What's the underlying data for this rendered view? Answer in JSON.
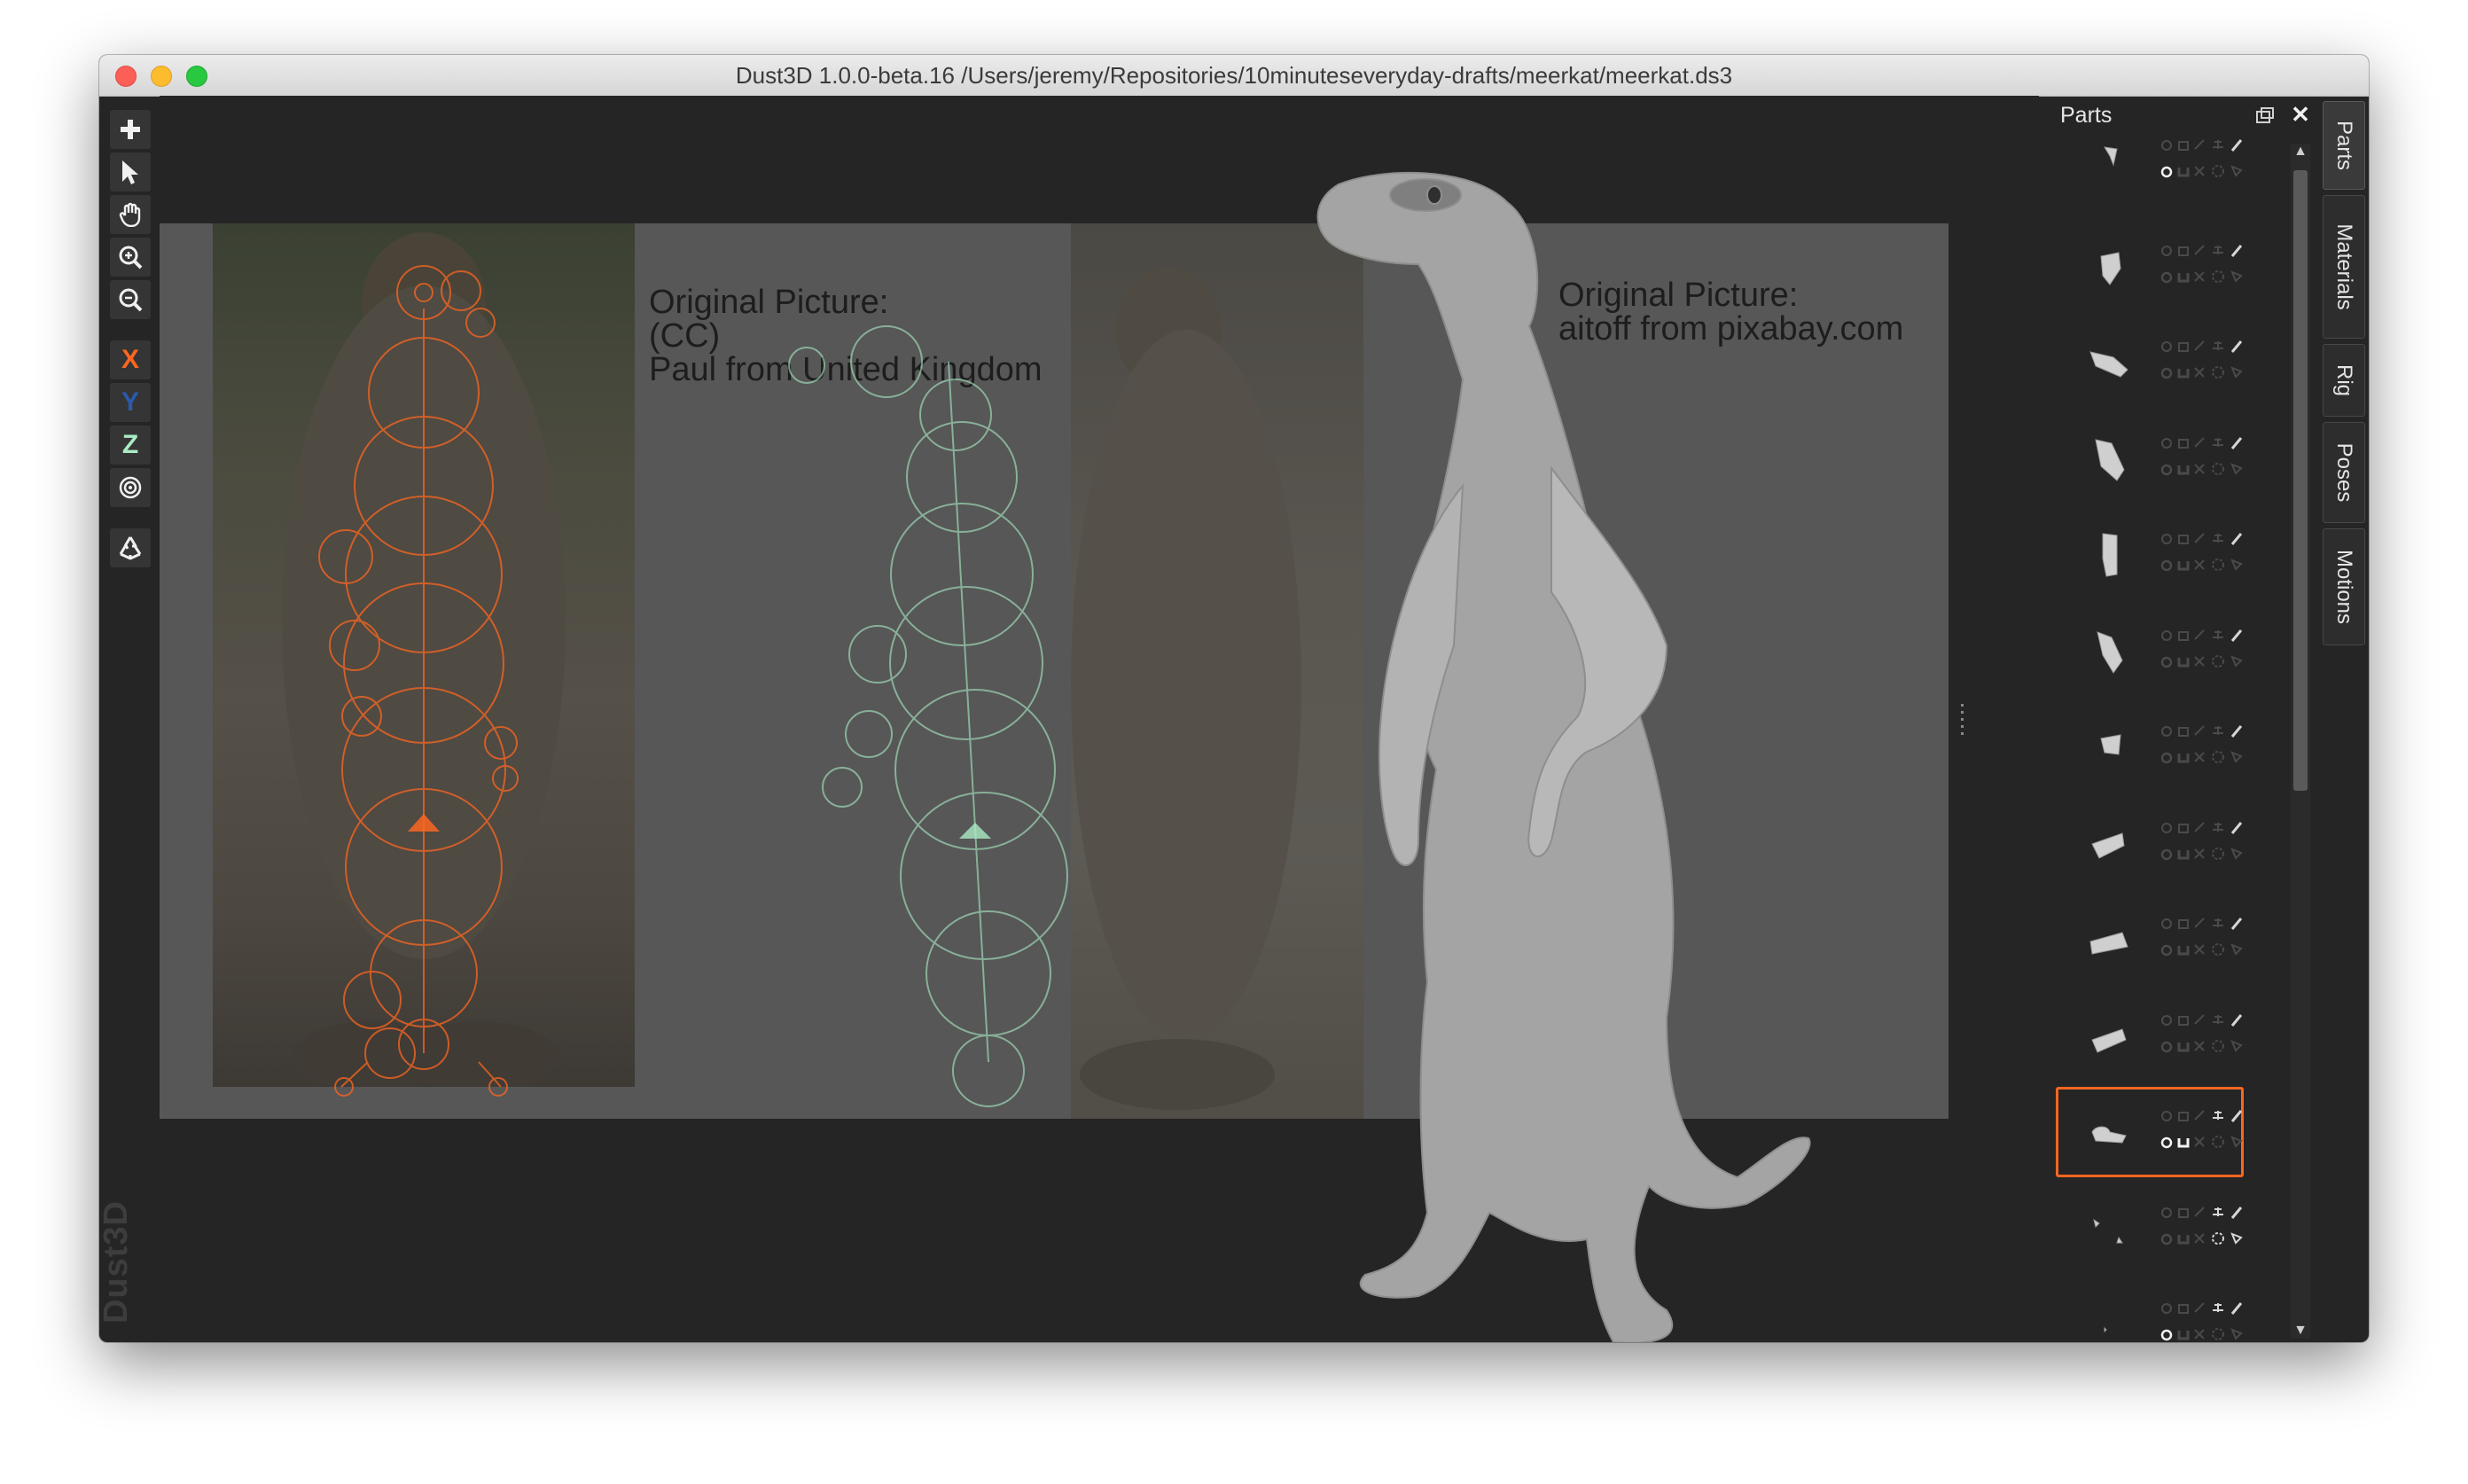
{
  "window": {
    "title": "Dust3D 1.0.0-beta.16 /Users/jeremy/Repositories/10minuteseveryday-drafts/meerkat/meerkat.ds3"
  },
  "toolbar": {
    "tools": [
      {
        "name": "add-tool",
        "icon": "plus-icon"
      },
      {
        "name": "select-tool",
        "icon": "cursor-arrow-icon"
      },
      {
        "name": "pan-tool",
        "icon": "hand-icon"
      },
      {
        "name": "zoom-in-tool",
        "icon": "zoom-in-icon"
      },
      {
        "name": "zoom-out-tool",
        "icon": "zoom-out-icon"
      }
    ],
    "x_label": "X",
    "y_label": "Y",
    "z_label": "Z",
    "colors": {
      "x": "#fc6621",
      "y": "#2a5aac",
      "z": "#aaebc4"
    },
    "brand": "Dust3D"
  },
  "canvas": {
    "caption_left": [
      "Original Picture:",
      "(CC)",
      "Paul from United Kingdom"
    ],
    "caption_right": [
      "Original Picture:",
      "aitoff from pixabay.com"
    ],
    "colors": {
      "front_view_nodes": "#fc6621",
      "side_view_nodes": "#aaebc4",
      "model": "#a4a4a4"
    }
  },
  "parts_panel": {
    "title": "Parts",
    "selected_index": 10,
    "part_count": 13,
    "accent": "#fc6621"
  },
  "side_tabs": [
    "Parts",
    "Materials",
    "Rig",
    "Poses",
    "Motions"
  ]
}
